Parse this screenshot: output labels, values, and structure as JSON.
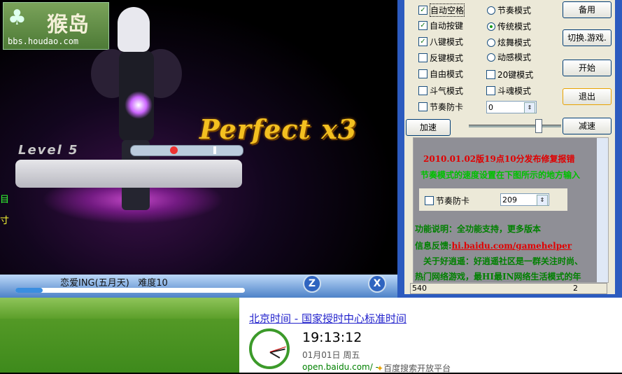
{
  "game": {
    "logo_text": "猴岛",
    "logo_url": "bbs.houdao.com",
    "judgement": "Perfect x3",
    "level_label": "Level 5",
    "edge_text_1": "目",
    "edge_text_2": "寸",
    "song_title": "恋爱ING(五月天)",
    "difficulty": "难度10",
    "progress_fraction": 0.12,
    "key_z": "Z",
    "key_x": "X"
  },
  "panel": {
    "checkboxes": [
      {
        "label": "自动空格",
        "checked": true
      },
      {
        "label": "自动按键",
        "checked": true
      },
      {
        "label": "八键模式",
        "checked": true
      },
      {
        "label": "反键模式",
        "checked": false
      },
      {
        "label": "自由模式",
        "checked": false
      },
      {
        "label": "斗气模式",
        "checked": false
      },
      {
        "label": "节奏防卡",
        "checked": false
      }
    ],
    "radios": [
      {
        "label": "节奏模式",
        "selected": false
      },
      {
        "label": "传统模式",
        "selected": true
      },
      {
        "label": "炫舞模式",
        "selected": false
      },
      {
        "label": "动感模式",
        "selected": false
      }
    ],
    "right_checks": [
      {
        "label": "20键模式",
        "checked": false
      },
      {
        "label": "斗魂模式",
        "checked": false
      }
    ],
    "spin_value": "0",
    "buttons": {
      "backup": "备用",
      "switch_game": "切换.游戏.",
      "start": "开始",
      "exit": "退出",
      "speed_up": "加速",
      "slow_down": "减速"
    },
    "speed_level_fraction": 0.75,
    "info": {
      "line1": "2010.01.02版19点10分发布修复报错",
      "line2": "节奏模式的速度设置在下图所示的地方输入",
      "mini_checkbox": "节奏防卡",
      "mini_value": "209",
      "line3": "功能说明：全功能支持，更多版本",
      "line4_label": "信息反馈:",
      "line4_link": "hi.baidu.com/gamehelper",
      "line5": "关于好逍遥：好逍遥社区是一群关注时尚、",
      "line6": "热门网络游戏，最HI最IN网络生活模式的年"
    },
    "status": {
      "left": "540",
      "right": "2"
    }
  },
  "baidu": {
    "title": "北京时间 - 国家授时中心标准时间",
    "time": "19:13:12",
    "date": "01月01日    周五",
    "url": "open.baidu.com/ -",
    "source": "百度搜索开放平台"
  },
  "colors": {
    "panel_blue": "#2c5bbf",
    "info_red": "#e00000",
    "info_green": "#00c000",
    "info_green_dark": "#008000",
    "link_blue": "#2222cc"
  }
}
